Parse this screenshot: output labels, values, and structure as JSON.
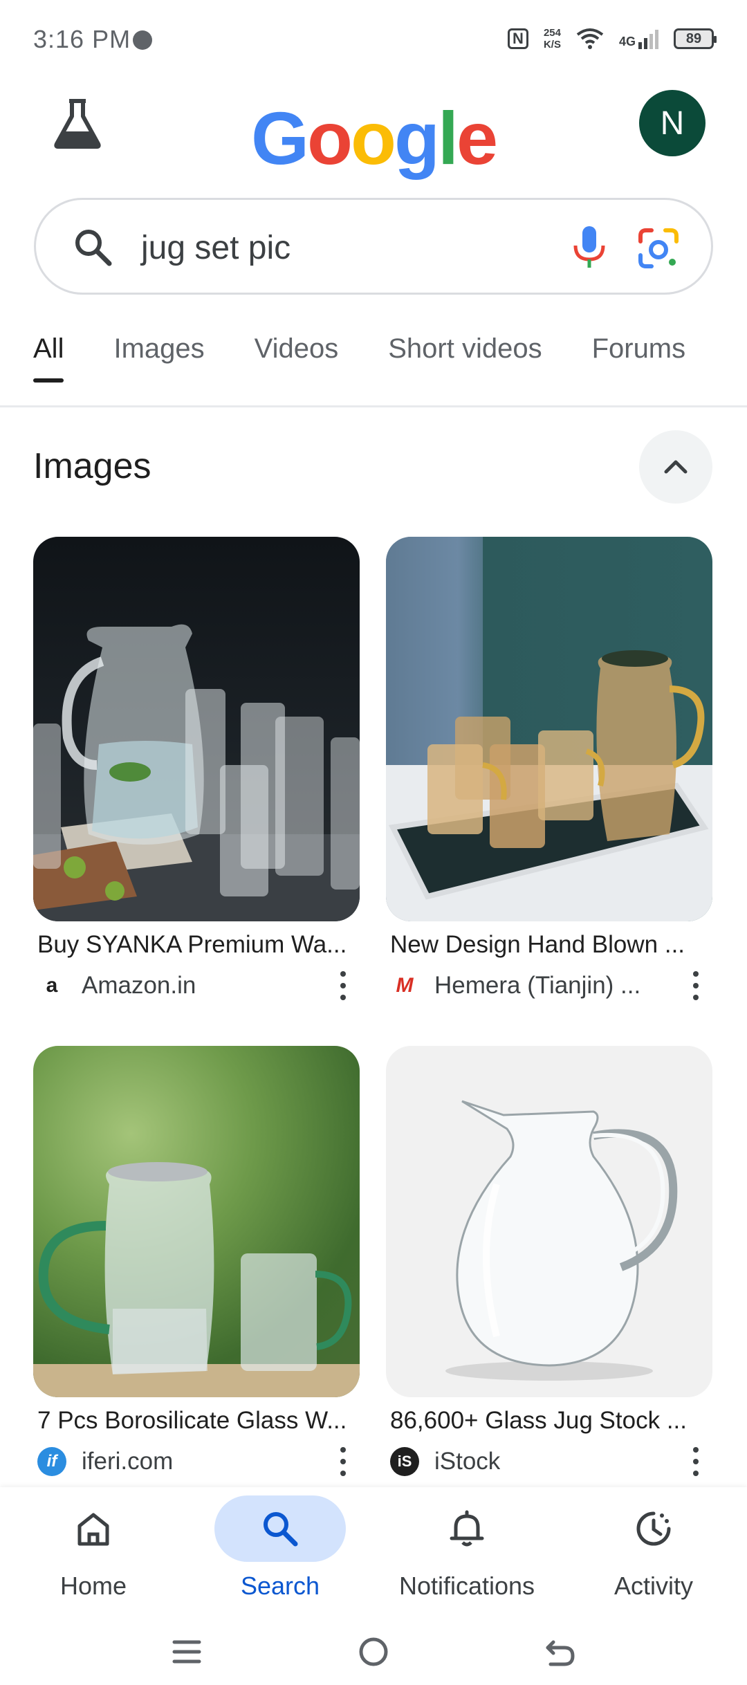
{
  "status_bar": {
    "time": "3:16 PM",
    "nfc": "N",
    "speed_value": "254",
    "speed_unit": "K/S",
    "network": "4G",
    "battery": "89"
  },
  "header": {
    "logo_letters": [
      "G",
      "o",
      "o",
      "g",
      "l",
      "e"
    ],
    "avatar_initial": "N"
  },
  "search": {
    "query": "jug set pic"
  },
  "tabs": [
    "All",
    "Images",
    "Videos",
    "Short videos",
    "Forums"
  ],
  "images_section": {
    "title": "Images",
    "results": [
      {
        "caption": "Buy SYANKA Premium Wa...",
        "source": "Amazon.in",
        "favicon": "a"
      },
      {
        "caption": "New Design Hand Blown ...",
        "source": "Hemera (Tianjin) ...",
        "favicon": "M"
      },
      {
        "caption": "7 Pcs Borosilicate Glass W...",
        "source": "iferi.com",
        "favicon": "if"
      },
      {
        "caption": "86,600+ Glass Jug Stock ...",
        "source": "iStock",
        "favicon": "iS"
      }
    ]
  },
  "bottom_nav": [
    {
      "label": "Home",
      "icon": "home-icon"
    },
    {
      "label": "Search",
      "icon": "search-icon"
    },
    {
      "label": "Notifications",
      "icon": "bell-icon"
    },
    {
      "label": "Activity",
      "icon": "activity-icon"
    }
  ],
  "colors": {
    "avatar": "#0b4a39",
    "accent": "#0b57d0",
    "active_pill": "#d3e3fd"
  }
}
